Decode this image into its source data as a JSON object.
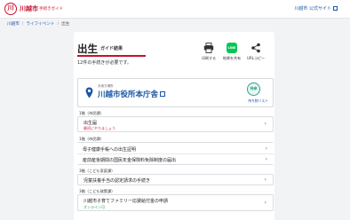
{
  "header": {
    "logo_mark": "川",
    "logo_name": "川越市",
    "logo_sub": "手続きガイド",
    "official_link": "川越市 公式サイト"
  },
  "breadcrumb": [
    "川越市",
    "ライフイベント",
    "出生"
  ],
  "page": {
    "title": "出生",
    "subtitle": "ガイド結果",
    "count_text": "12件の手続きが必要です。"
  },
  "actions": {
    "print_label": "印刷する",
    "line_label": "結果を共有",
    "line_icon_text": "LINE",
    "url_label": "URLコピー"
  },
  "office": {
    "caption": "手続き場所",
    "name": "川越市役所本庁舎",
    "bring_icon_text": "持参",
    "bring_label": "持ち物リスト"
  },
  "procedures": [
    {
      "group": "1階（市民課）",
      "title": "出生届",
      "note": "最初にやりましょう",
      "note_color": "red"
    },
    {
      "group": "1階（市民課）",
      "title": "母子健康手帳への出生証明",
      "note": "",
      "note_color": ""
    },
    {
      "group": "",
      "title": "産前産後期間の国民年金保険料免除制度の届出",
      "note": "",
      "note_color": ""
    },
    {
      "group": "3階（こども家庭課）",
      "title": "児童扶養手当の認定請求の手続き",
      "note": "",
      "note_color": ""
    },
    {
      "group": "3階（こども政策課）",
      "title": "川越市子育てファミリー応援給付金の申請",
      "note": "オンライン可",
      "note_color": "green"
    }
  ]
}
